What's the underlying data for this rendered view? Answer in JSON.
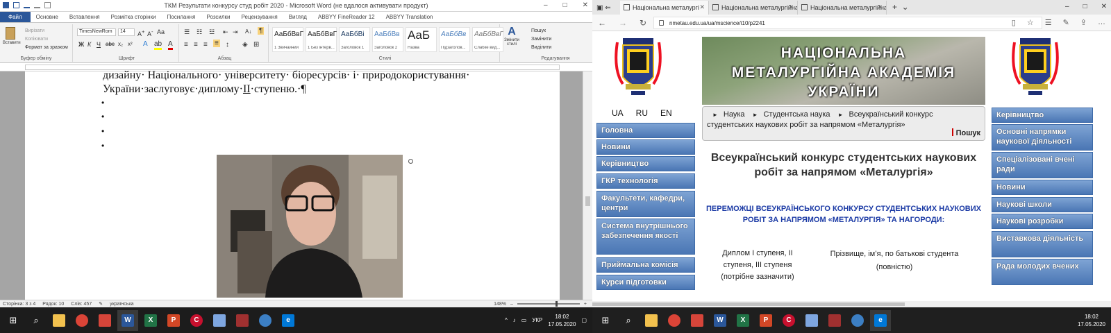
{
  "word": {
    "title": "ТКМ Результати конкурсу студ робіт 2020  -  Microsoft Word (не вдалося активувати продукт)",
    "tabs": [
      "Файл",
      "Основне",
      "Вставлення",
      "Розмітка сторінки",
      "Посилання",
      "Розсилки",
      "Рецензування",
      "Вигляд",
      "ABBYY FineReader 12",
      "ABBYY Translation"
    ],
    "clipboard": {
      "paste": "Вставити",
      "cut": "Вирізати",
      "copy": "Копіювати",
      "format_painter": "Формат за зразком",
      "group": "Буфер обміну"
    },
    "font": {
      "name": "TimesNewRom",
      "size": "14",
      "group": "Шрифт"
    },
    "paragraph_group": "Абзац",
    "styles": [
      {
        "preview": "АаБбВвГ",
        "name": "1 Звичайний"
      },
      {
        "preview": "АаБбВвГ",
        "name": "1 Без інтерв..."
      },
      {
        "preview": "АаБбВі",
        "name": "Заголовок 1"
      },
      {
        "preview": "АаБбВв",
        "name": "Заголовок 2"
      },
      {
        "preview": "АаБ",
        "name": "Назва"
      },
      {
        "preview": "АаБбВв",
        "name": "Підзаголов..."
      },
      {
        "preview": "АаБбВвГ",
        "name": "Слабке вид..."
      }
    ],
    "styles_group": "Стилі",
    "change_styles": "Змінити стилі",
    "editing": {
      "find": "Пошук",
      "replace": "Замінити",
      "select": "Виділити",
      "group": "Редагування"
    },
    "doc_line1": "дизайну· Національного· університету· біоресурсів· і· природокористування·",
    "doc_line2_pre": "України·заслуговує·диплому·",
    "doc_line2_roman": "ІІ",
    "doc_line2_post": "·ступеню.·¶",
    "bullets": [
      "•",
      "•",
      "•",
      "•"
    ],
    "status": {
      "page": "Сторінка: 3 з 4",
      "row": "Рядок: 10",
      "words": "Слів: 457",
      "lang": "українська",
      "zoom": "148%"
    }
  },
  "edge": {
    "tabs": [
      "Національна металургі",
      "Національна металургійна",
      "Національна металургійна"
    ],
    "url": "nmetau.edu.ua/ua/mscience/i10/p2241"
  },
  "site": {
    "banner": [
      "НАЦІОНАЛЬНА",
      "МЕТАЛУРГІЙНА АКАДЕМІЯ",
      "УКРАЇНИ"
    ],
    "langs": [
      "UA",
      "RU",
      "EN"
    ],
    "left_menu": [
      "Головна",
      "Новини",
      "Керівництво",
      "ГКР технологія",
      "Факультети, кафедри, центри",
      "Система внутрішнього забезпечення якості",
      "Приймальна комісія",
      "Курси підготовки"
    ],
    "right_menu": [
      "Керівництво",
      "Основні напрямки наукової діяльності",
      "Спеціалізовані вчені ради",
      "Новини",
      "Наукові школи",
      "Наукові розробки",
      "Виставкова діяльність",
      "Рада молодих вчених"
    ],
    "breadcrumbs": [
      "Наука",
      "Студентська наука",
      "Всеукраїнський конкурс студентських наукових робіт за напрямом «Металургія»"
    ],
    "search": "Пошук",
    "heading": "Всеукраїнський конкурс студентських наукових робіт за напрямом «Металургія»",
    "winners": "ПЕРЕМОЖЦІ ВСЕУКРАЇНСЬКОГО КОНКУРСУ СТУДЕНТСЬКИХ НАУКОВИХ РОБІТ ЗА НАПРЯМОМ «МЕТАЛУРГІЯ» ТА НАГОРОДИ:",
    "col1": "Диплом І ступеня, ІІ ступеня, ІІІ ступеня (потрібне зазначити)",
    "col2": "Прізвище, ім’я, по батькові студента (повністю)"
  },
  "taskbar_left": {
    "lang": "УКР",
    "time": "18:02",
    "date": "17.05.2020"
  },
  "taskbar_right": {
    "time": "18:02",
    "date": "17.05.2020"
  }
}
